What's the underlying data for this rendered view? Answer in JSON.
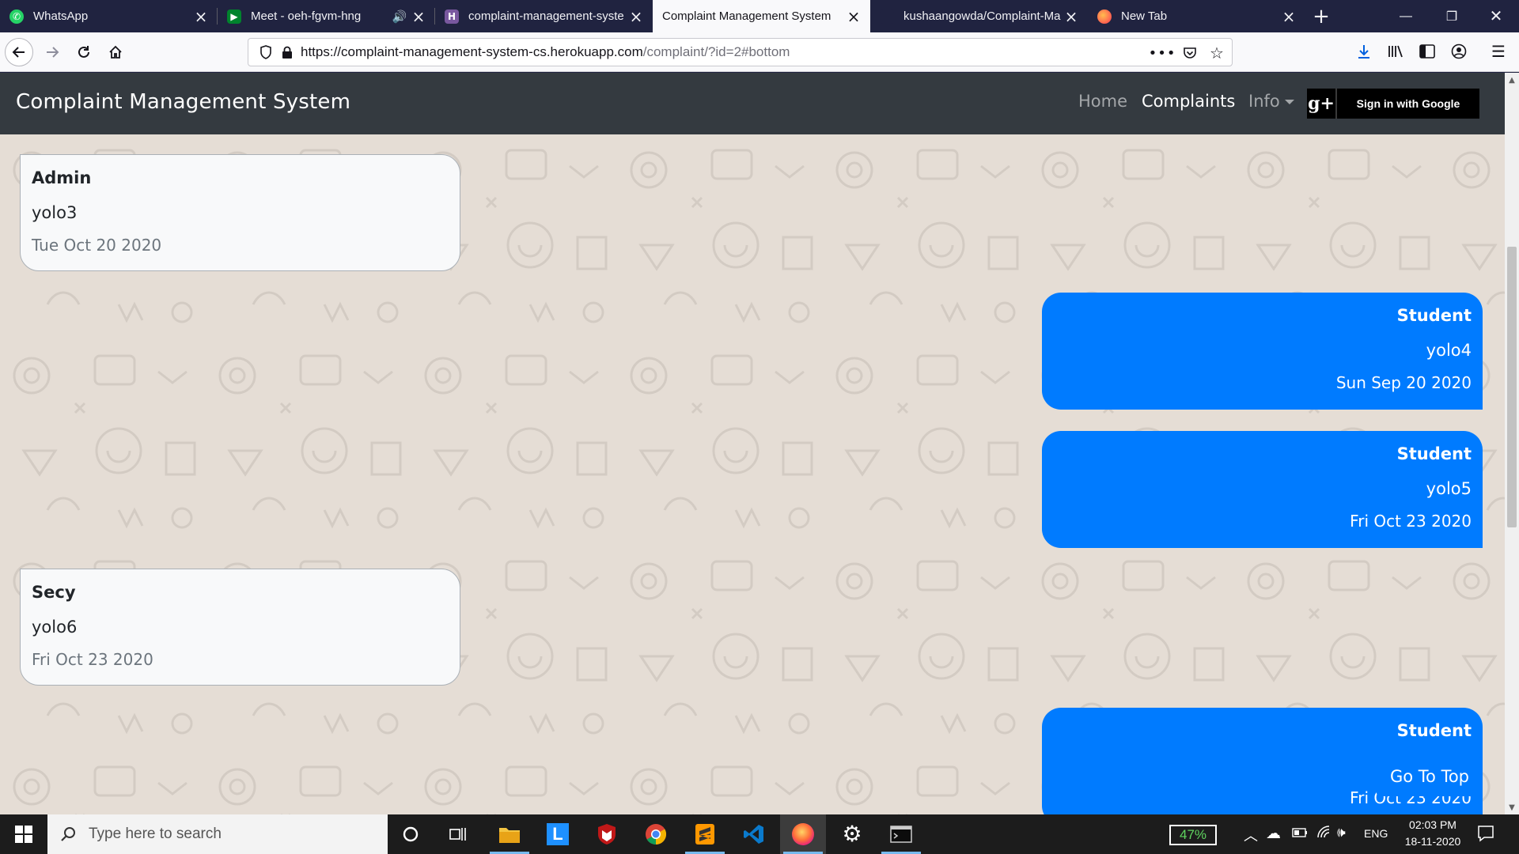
{
  "browser": {
    "tabs": [
      {
        "title": "WhatsApp",
        "icon": "whatsapp-icon",
        "color": "#25d366",
        "active": false
      },
      {
        "title": "Meet - oeh-fgvm-hng",
        "icon": "google-meet-icon",
        "color": "#00832d",
        "active": false,
        "audio": true
      },
      {
        "title": "complaint-management-syste",
        "icon": "heroku-icon",
        "color": "#79589f",
        "active": false
      },
      {
        "title": "Complaint Management System",
        "icon": "page-icon",
        "color": "#15141a",
        "active": true
      },
      {
        "title": "kushaangowda/Complaint-Ma",
        "icon": "github-icon",
        "color": "#15141a",
        "active": false
      },
      {
        "title": "New Tab",
        "icon": "firefox-icon",
        "color": "#ff7139",
        "active": false
      }
    ],
    "url_host": "https://complaint-management-system-cs.herokuapp.com",
    "url_path": "/complaint/?id=2#bottom"
  },
  "site": {
    "brand": "Complaint Management System",
    "nav": {
      "home": "Home",
      "complaints": "Complaints",
      "info": "Info"
    },
    "google_button": "Sign in with Google",
    "google_icon_text": "g+"
  },
  "messages": [
    {
      "sender": "Admin",
      "text": "yolo3",
      "date": "Tue Oct 20 2020",
      "side": "left"
    },
    {
      "sender": "Student",
      "text": "yolo4",
      "date": "Sun Sep 20 2020",
      "side": "right"
    },
    {
      "sender": "Student",
      "text": "yolo5",
      "date": "Fri Oct 23 2020",
      "side": "right"
    },
    {
      "sender": "Secy",
      "text": "yolo6",
      "date": "Fri Oct 23 2020",
      "side": "left"
    },
    {
      "sender": "Student",
      "text": "",
      "date": "Fri Oct 23 2020",
      "side": "right"
    }
  ],
  "go_to_top": "Go To Top",
  "taskbar": {
    "search_placeholder": "Type here to search",
    "battery": "47%",
    "language": "ENG",
    "time": "02:03 PM",
    "date": "18-11-2020"
  }
}
